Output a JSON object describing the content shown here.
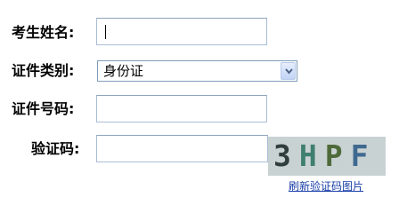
{
  "form": {
    "name_label": "考生姓名:",
    "id_type_label": "证件类别:",
    "id_type_selected": "身份证",
    "id_number_label": "证件号码:",
    "captcha_label": "验证码:",
    "captcha_chars": [
      "3",
      "H",
      "P",
      "F"
    ],
    "refresh_link": "刷新验证码图片"
  },
  "colors": {
    "captcha_chars": [
      "#2f3d3d",
      "#3f7f6f",
      "#4e6a3a",
      "#3f6a90"
    ]
  }
}
